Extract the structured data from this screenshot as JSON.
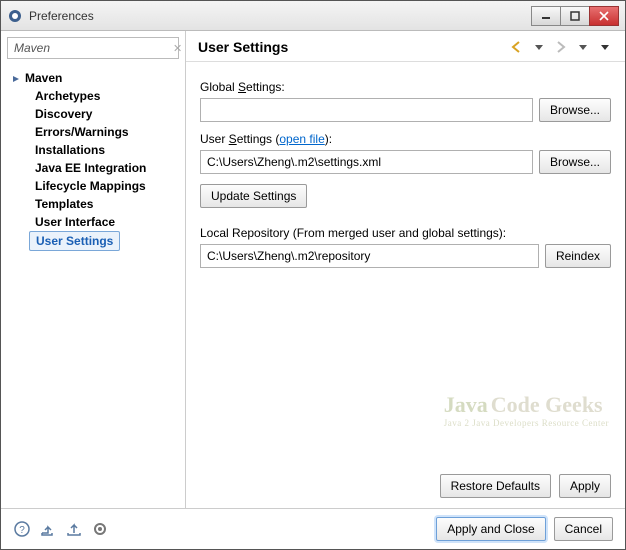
{
  "titlebar": {
    "title": "Preferences"
  },
  "filter": {
    "value": "Maven"
  },
  "tree": {
    "root": "Maven",
    "items": [
      "Archetypes",
      "Discovery",
      "Errors/Warnings",
      "Installations",
      "Java EE Integration",
      "Lifecycle Mappings",
      "Templates",
      "User Interface",
      "User Settings"
    ],
    "selected_index": 8
  },
  "main": {
    "heading": "User Settings",
    "global_settings_label": "Global Settings:",
    "global_settings_value": "",
    "browse_label": "Browse...",
    "user_settings_label_pre": "User Settings (",
    "user_settings_link": "open file",
    "user_settings_label_post": "):",
    "user_settings_value": "C:\\Users\\Zheng\\.m2\\settings.xml",
    "update_settings_label": "Update Settings",
    "local_repo_label": "Local Repository (From merged user and global settings):",
    "local_repo_value": "C:\\Users\\Zheng\\.m2\\repository",
    "reindex_label": "Reindex"
  },
  "action_row": {
    "restore_defaults": "Restore Defaults",
    "apply": "Apply"
  },
  "footer": {
    "apply_and_close": "Apply and Close",
    "cancel": "Cancel"
  },
  "watermark": {
    "line1a": "Java",
    "line1b": "Code Geeks",
    "line2": "Java 2 Java Developers Resource Center"
  }
}
